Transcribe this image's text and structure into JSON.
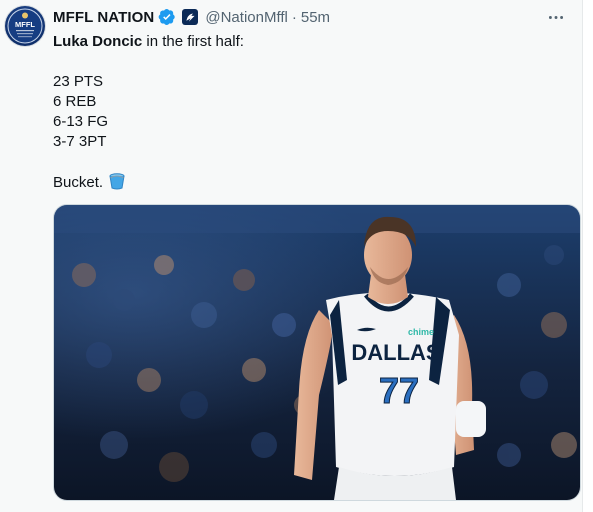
{
  "tweet": {
    "author": {
      "name": "MFFL NATION",
      "handle": "@NationMffl",
      "separator": "·",
      "time": "55m",
      "avatar_icon": "mffl-logo",
      "avatar_text": "MFFL",
      "verified_icon": "verified-badge-icon",
      "affiliate_icon": "mavericks-affiliate-icon"
    },
    "more_icon": "more-options-icon",
    "text": {
      "subject": "Luka Doncic",
      "intro_rest": " in the first half:",
      "stats": [
        "23 PTS",
        "6 REB",
        "6-13 FG",
        "3-7 3PT"
      ],
      "closing": "Bucket.",
      "emoji": "bucket-emoji"
    },
    "media": {
      "description_icon": "player-photo",
      "jersey_team": "DALLAS",
      "jersey_number": "77",
      "jersey_sponsor": "chime"
    }
  },
  "colors": {
    "background": "#f7f9f9",
    "text": "#0f1419",
    "secondary_text": "#536471",
    "verified_blue": "#1d9bf0",
    "jersey_navy": "#0c2340",
    "jersey_blue": "#2a6ebf"
  }
}
